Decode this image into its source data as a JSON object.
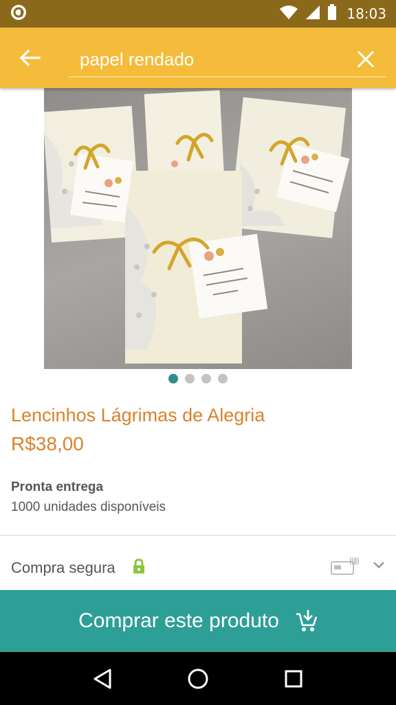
{
  "status_bar": {
    "time": "18:03",
    "icons": [
      "app-notification-icon",
      "wifi-icon",
      "signal-icon",
      "battery-icon"
    ]
  },
  "search": {
    "query": "papel rendado",
    "placeholder": ""
  },
  "product": {
    "image_description_icon": "product-photo",
    "carousel_dots": 4,
    "active_dot": 0,
    "title": "Lencinhos Lágrimas de Alegria",
    "price": "R$38,00",
    "availability_label": "Pronta entrega",
    "stock": "1000 unidades disponíveis"
  },
  "secure": {
    "label": "Compra segura",
    "icons": [
      "lock-icon",
      "payment-card-icon",
      "chevron-down-icon"
    ]
  },
  "buy_button": {
    "label": "Comprar este produto"
  },
  "nav": {
    "icons": [
      "back-triangle-icon",
      "home-circle-icon",
      "recents-square-icon"
    ]
  },
  "colors": {
    "status_bar": "#8a6a1a",
    "toolbar": "#f4bc3a",
    "accent_orange": "#d9822b",
    "teal": "#2e9f97",
    "dot_active": "#2f8c8c",
    "lock_green": "#8cc63f"
  }
}
